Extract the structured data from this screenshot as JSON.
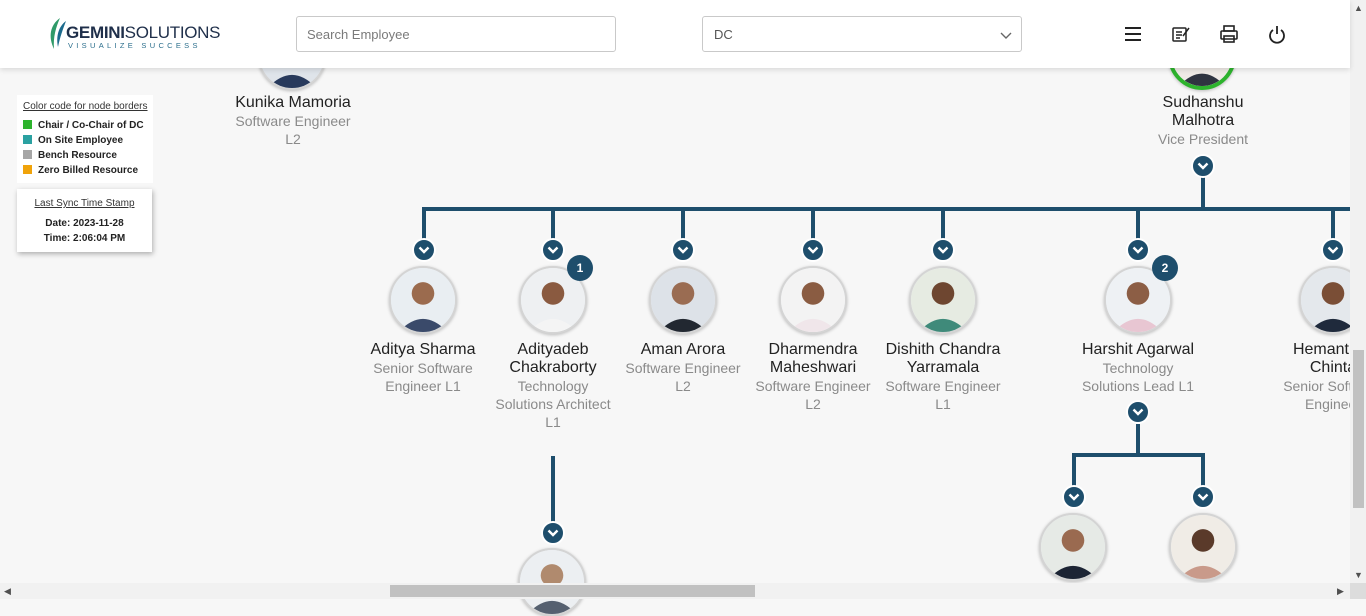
{
  "header": {
    "logo": {
      "name_bold": "GEMINI",
      "name_rest": "SOLUTIONS",
      "tagline": "VISUALIZE SUCCESS"
    },
    "search": {
      "placeholder": "Search Employee",
      "value": ""
    },
    "select": {
      "value": "DC"
    },
    "icons": [
      "menu-icon",
      "notes-icon",
      "print-icon",
      "power-icon"
    ]
  },
  "legend": {
    "title": "Color code for node borders",
    "items": [
      {
        "label": "Chair / Co-Chair of DC",
        "color": "#2db32d"
      },
      {
        "label": "On Site Employee",
        "color": "#2aa1a1"
      },
      {
        "label": "Bench Resource",
        "color": "#a6a6a6"
      },
      {
        "label": "Zero Billed Resource",
        "color": "#f0a30a"
      }
    ]
  },
  "sync": {
    "title": "Last Sync Time Stamp",
    "date": "Date: 2023-11-28",
    "time": "Time: 2:06:04 PM"
  },
  "colors": {
    "connector": "#1e4e6c",
    "chair_border": "#2db32d"
  },
  "nodes": {
    "kunika": {
      "name": "Kunika Mamoria",
      "role": "Software Engineer L2"
    },
    "sudhanshu": {
      "name": "Sudhanshu Malhotra",
      "role": "Vice President"
    },
    "aditya": {
      "name": "Aditya Sharma",
      "role": "Senior Software Engineer L1"
    },
    "adityadeb": {
      "name": "Adityadeb Chakraborty",
      "role": "Technology Solutions Architect L1",
      "reports": "1"
    },
    "aman": {
      "name": "Aman Arora",
      "role": "Software Engineer L2"
    },
    "dharmendra": {
      "name": "Dharmendra Maheshwari",
      "role": "Software Engineer L2"
    },
    "dishith": {
      "name": "Dishith Chandra Yarramala",
      "role": "Software Engineer L1"
    },
    "harshit": {
      "name": "Harshit Agarwal",
      "role": "Technology Solutions Lead L1",
      "reports": "2"
    },
    "hemanth": {
      "name": "Hemanth K Chinta",
      "role": "Senior Software Engineer"
    }
  }
}
